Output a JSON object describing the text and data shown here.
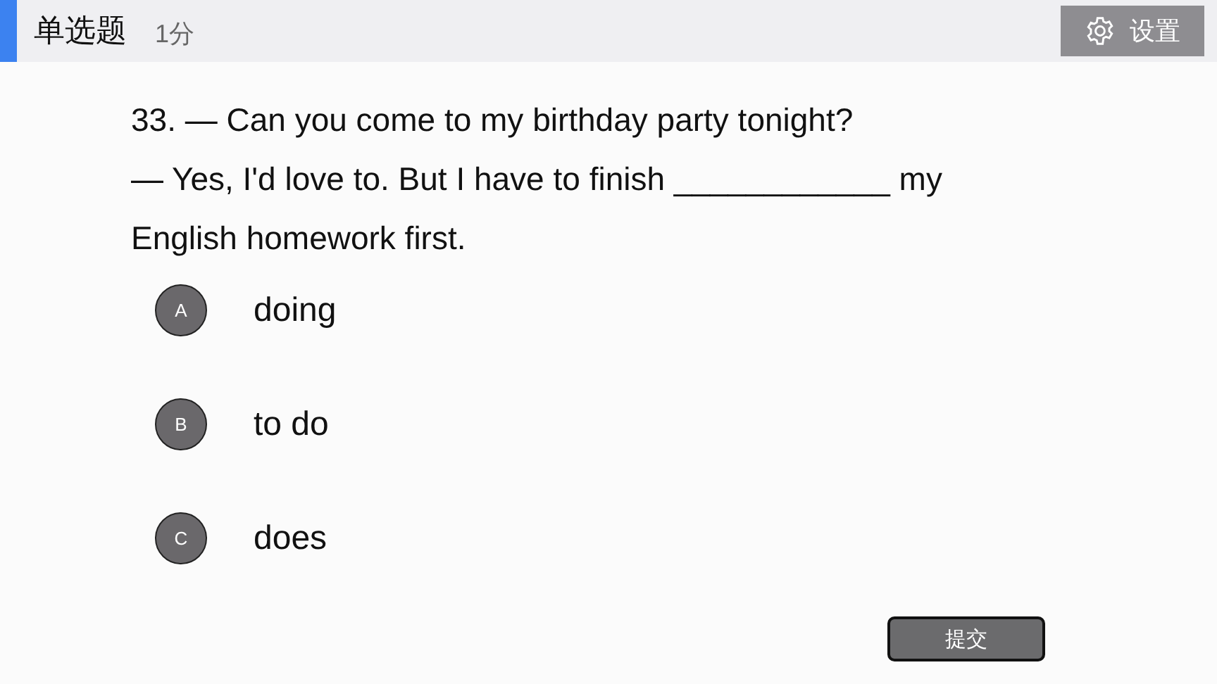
{
  "header": {
    "title": "单选题",
    "score": "1分",
    "settings_button": "设置"
  },
  "question": {
    "lines": [
      "33. — Can you come to my birthday party tonight?",
      "— Yes, I'd love to. But I have to finish ____________ my English homework first."
    ]
  },
  "options": [
    {
      "letter": "A",
      "text": "doing",
      "selected": false
    },
    {
      "letter": "B",
      "text": "to do",
      "selected": false
    },
    {
      "letter": "C",
      "text": "does",
      "selected": false
    }
  ],
  "submit_button": "提交"
}
